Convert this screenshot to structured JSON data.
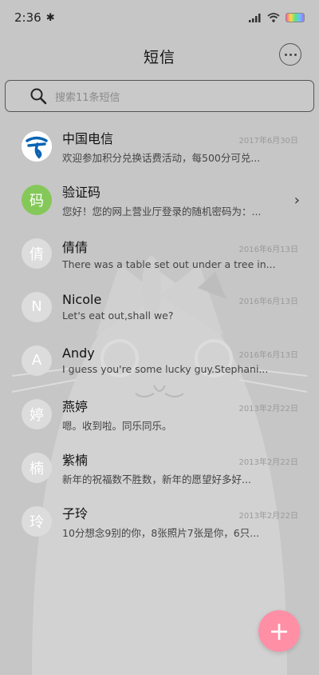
{
  "status": {
    "time": "2:36",
    "bt_icon": "bluetooth-icon"
  },
  "header": {
    "title": "短信",
    "more_icon": "more-icon"
  },
  "search": {
    "placeholder": "搜索11条短信"
  },
  "messages": [
    {
      "avatar": "",
      "avatar_style": "logo",
      "name": "中国电信",
      "date": "2017年6月30日",
      "preview": "欢迎参加积分兑换话费活动，每500分可兑..."
    },
    {
      "avatar": "码",
      "avatar_style": "green",
      "name": "验证码",
      "date": "",
      "preview": "您好！您的网上营业厅登录的随机密码为：..."
    },
    {
      "avatar": "倩",
      "avatar_style": "grey",
      "name": "倩倩",
      "date": "2016年6月13日",
      "preview": "There was a table set out under a tree in..."
    },
    {
      "avatar": "N",
      "avatar_style": "grey",
      "name": "Nicole",
      "date": "2016年6月13日",
      "preview": "Let's eat out,shall we?"
    },
    {
      "avatar": "A",
      "avatar_style": "grey",
      "name": "Andy",
      "date": "2016年6月13日",
      "preview": "I guess you're some lucky guy.Stephani..."
    },
    {
      "avatar": "婷",
      "avatar_style": "grey",
      "name": "燕婷",
      "date": "2013年2月22日",
      "preview": "嗯。收到啦。同乐同乐。"
    },
    {
      "avatar": "楠",
      "avatar_style": "grey",
      "name": "紫楠",
      "date": "2013年2月22日",
      "preview": "新年的祝福数不胜数，新年的愿望好多好..."
    },
    {
      "avatar": "玲",
      "avatar_style": "grey",
      "name": "子玲",
      "date": "2013年2月22日",
      "preview": "10分想念9别的你，8张照片7张是你，6只..."
    }
  ],
  "fab": {
    "label": "+"
  },
  "colors": {
    "background": "#c6c6c6",
    "fab": "#ff8fa5",
    "avatar_green": "#85c85a",
    "telecom_blue": "#0a64b4"
  }
}
